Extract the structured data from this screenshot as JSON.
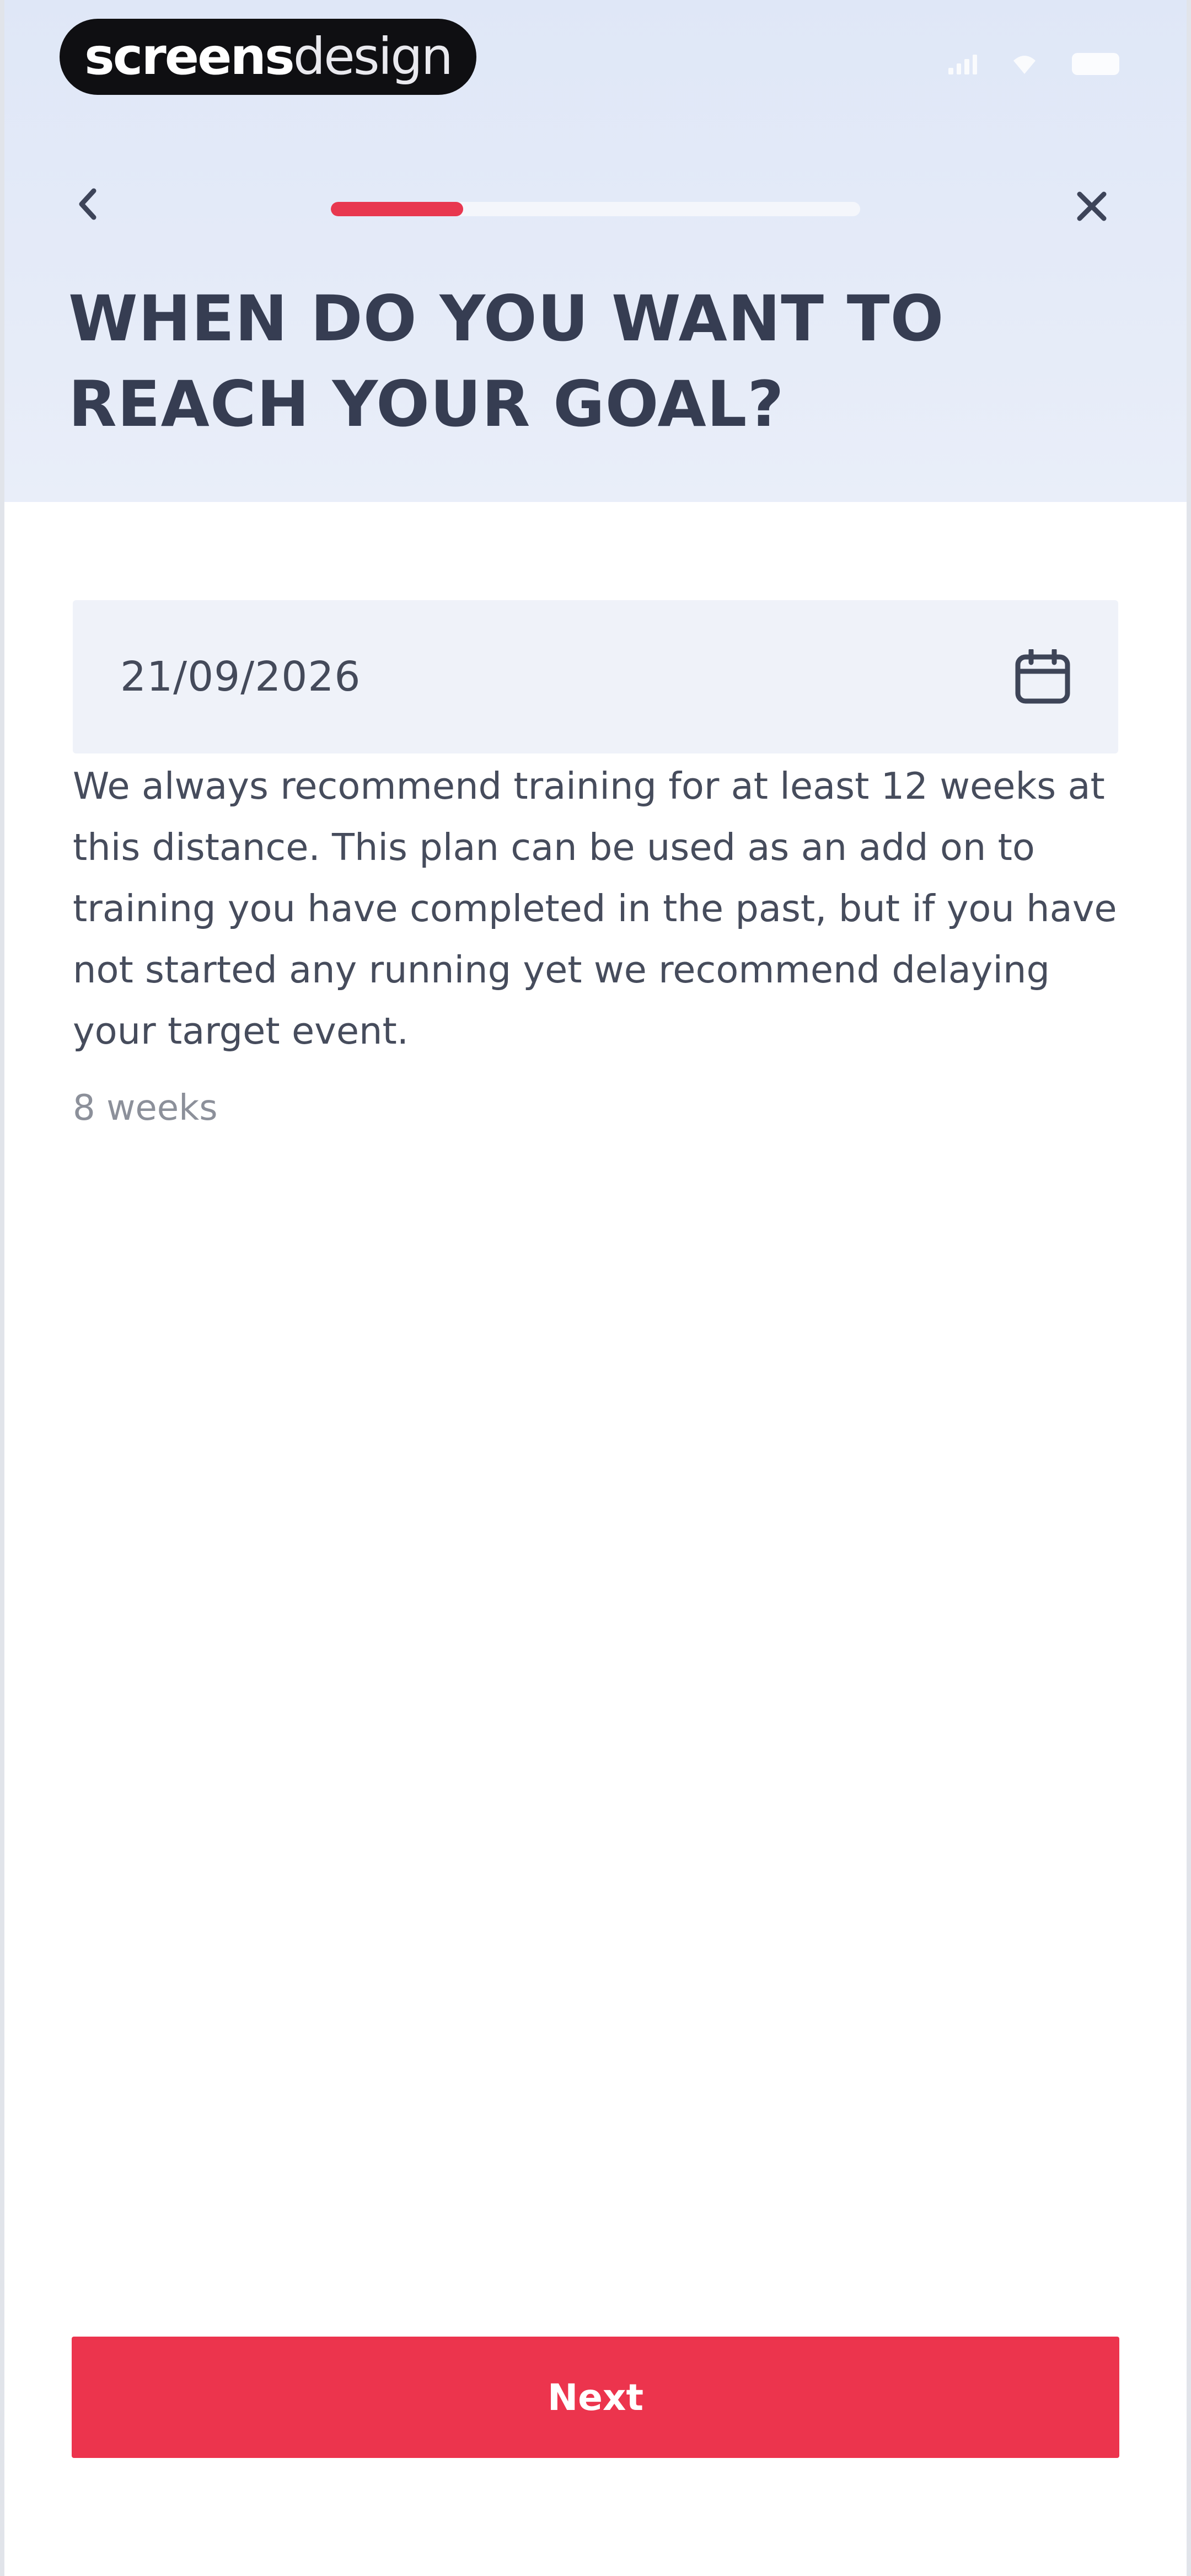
{
  "status_bar": {
    "brand_bold": "screens",
    "brand_light": "design",
    "icons": [
      "signal-icon",
      "wifi-icon",
      "battery-icon"
    ]
  },
  "navigation": {
    "back_icon": "chevron-left-icon",
    "close_icon": "close-icon",
    "progress": 0.25
  },
  "title": "WHEN DO YOU WANT TO REACH YOUR GOAL?",
  "date_field": {
    "value": "21/09/2026",
    "icon": "calendar-icon"
  },
  "description": "We always recommend training for at least 12 weeks at this distance. This plan can be used as an add on to training you have completed in the past, but if you have not started any running yet we recommend delaying your target event.",
  "weeks_label": "8 weeks",
  "next_button": {
    "label": "Next"
  },
  "colors": {
    "accent": "#ec344d",
    "header_bg": "#e3e9f8",
    "title": "#363d52",
    "field_bg": "#eff2f9"
  }
}
